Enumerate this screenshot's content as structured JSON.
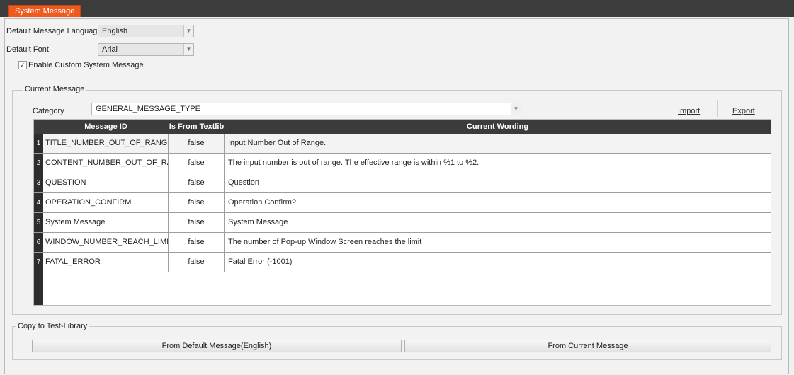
{
  "tab": {
    "title": "System Message"
  },
  "settings": {
    "language_label": "Default Message Languag",
    "language_value": "English",
    "font_label": "Default Font",
    "font_value": "Arial",
    "enable_custom_label": "Enable Custom System Message",
    "enable_custom_checked": true,
    "check_glyph": "✓"
  },
  "current_message": {
    "group_label": "Current Message",
    "category_label": "Category",
    "category_value": "GENERAL_MESSAGE_TYPE",
    "import_label": "Import",
    "export_label": "Export",
    "columns": [
      "Message ID",
      "Is From Textlib",
      "Current Wording"
    ],
    "rows": [
      {
        "num": "1",
        "id": "TITLE_NUMBER_OUT_OF_RANGE",
        "from_textlib": "false",
        "wording": "Input Number Out of Range."
      },
      {
        "num": "2",
        "id": "CONTENT_NUMBER_OUT_OF_RANGE",
        "from_textlib": "false",
        "wording": "The input number is out of range. The effective range is within %1 to %2."
      },
      {
        "num": "3",
        "id": "QUESTION",
        "from_textlib": "false",
        "wording": "Question"
      },
      {
        "num": "4",
        "id": "OPERATION_CONFIRM",
        "from_textlib": "false",
        "wording": "Operation Confirm?"
      },
      {
        "num": "5",
        "id": "System Message",
        "from_textlib": "false",
        "wording": "System Message"
      },
      {
        "num": "6",
        "id": "WINDOW_NUMBER_REACH_LIMIT",
        "from_textlib": "false",
        "wording": "The number of Pop-up Window Screen reaches the limit"
      },
      {
        "num": "7",
        "id": "FATAL_ERROR",
        "from_textlib": "false",
        "wording": "Fatal Error (-1001)"
      }
    ]
  },
  "copy": {
    "group_label": "Copy to Test-Library",
    "from_default_label": "From Default Message(English)",
    "from_current_label": "From Current Message"
  },
  "colors": {
    "accent": "#ef5b1f",
    "header_dark": "#3b3b3b"
  }
}
